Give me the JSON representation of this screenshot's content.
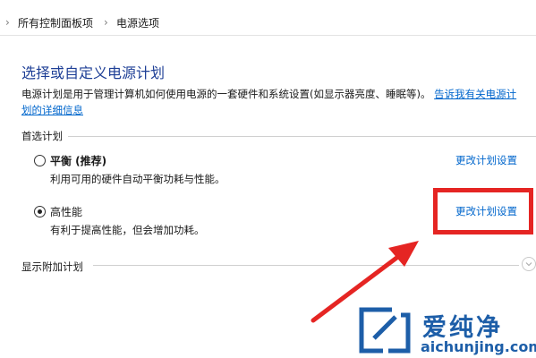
{
  "breadcrumb": {
    "items": [
      "所有控制面板项",
      "电源选项"
    ],
    "separator": "›"
  },
  "header": {
    "title": "选择或自定义电源计划"
  },
  "description": {
    "text": "电源计划是用于管理计算机如何使用电源的一套硬件和系统设置(如显示器亮度、睡眠等)。",
    "link_part1": "告诉我有关电源计",
    "link_part2": "划的详细信息"
  },
  "preferred_section": {
    "label": "首选计划",
    "plans": [
      {
        "name": "平衡 (推荐)",
        "description": "利用可用的硬件自动平衡功耗与性能。",
        "selected": false,
        "change_link": "更改计划设置"
      },
      {
        "name": "高性能",
        "description": "有利于提高性能，但会增加功耗。",
        "selected": true,
        "change_link": "更改计划设置"
      }
    ]
  },
  "additional_section": {
    "label": "显示附加计划"
  },
  "annotation": {
    "box_color": "#e52523",
    "arrow_color": "#e52523"
  },
  "watermark": {
    "chinese": "爱纯净",
    "url": "aichunjing.com",
    "color": "#1d5ea8"
  },
  "icons": {
    "chevron_down": "chevron-down-icon",
    "watermark_logo": "aichunjing-logo-icon"
  }
}
